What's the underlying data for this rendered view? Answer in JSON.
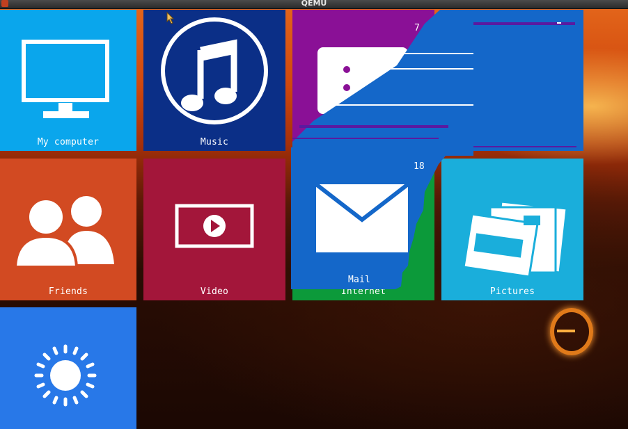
{
  "window": {
    "title": "QEMU"
  },
  "tiles": {
    "my_computer": {
      "label": "My computer",
      "color": "#0aa6ec"
    },
    "music": {
      "label": "Music",
      "color": "#0b2f87"
    },
    "messaging": {
      "badge": "7",
      "color": "#8a1096"
    },
    "overlay_top": {
      "color": "#1467c9"
    },
    "friends": {
      "label": "Friends",
      "color": "#d24a22"
    },
    "video": {
      "label": "Video",
      "color": "#a3163a"
    },
    "internet": {
      "label": "Internet",
      "color": "#0c9a3a"
    },
    "mail": {
      "label": "Mail",
      "badge": "18",
      "color": "#1467c9"
    },
    "pictures": {
      "label": "Pictures",
      "color": "#1aaedb"
    },
    "weather": {
      "color": "#2878e8"
    }
  }
}
